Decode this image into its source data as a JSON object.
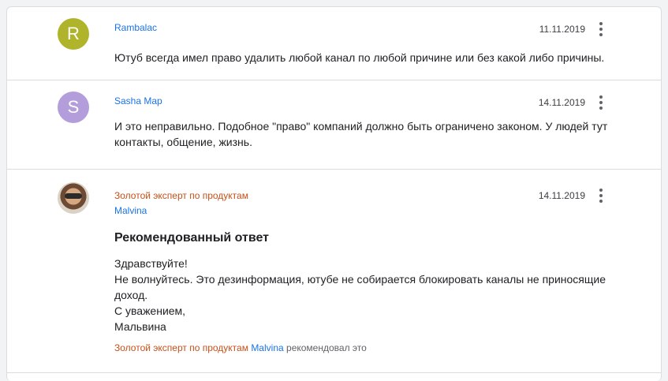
{
  "posts": [
    {
      "avatar_letter": "R",
      "avatar_color": "#afb42b",
      "author": "Rambalac",
      "date": "11.11.2019",
      "text": "Ютуб всегда имел право удалить любой канал по любой причине или без какой либо причины."
    },
    {
      "avatar_letter": "S",
      "avatar_color": "#b39ddb",
      "author": "Sasha Map",
      "date": "14.11.2019",
      "text": "И это неправильно. Подобное \"право\" компаний должно быть ограничено законом. У людей тут контакты, общение, жизнь."
    },
    {
      "expert_label": "Золотой эксперт по продуктам",
      "author": "Malvina",
      "date": "14.11.2019",
      "answer_title": "Рекомендованный ответ",
      "text_lines": [
        "Здравствуйте!",
        "Не волнуйтесь. Это дезинформация, ютубе не собирается блокировать каналы не приносящие",
        "доход.",
        "С уважением,",
        "Мальвина"
      ],
      "recommended": {
        "expert": "Золотой эксперт по продуктам",
        "name": "Malvina",
        "suffix": "рекомендовал это"
      }
    }
  ],
  "colors": {
    "link": "#1a73e8",
    "expert": "#c5501a"
  }
}
